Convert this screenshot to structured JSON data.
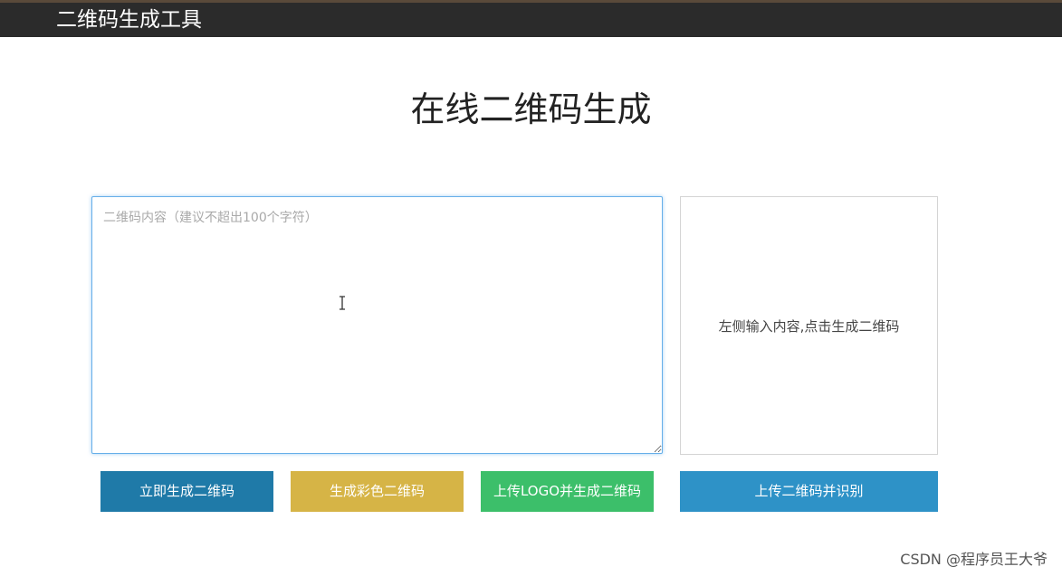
{
  "header": {
    "brand": "二维码生成工具"
  },
  "main": {
    "title": "在线二维码生成",
    "content_input": {
      "value": "",
      "placeholder": "二维码内容（建议不超出100个字符）"
    },
    "preview": {
      "hint": "左侧输入内容,点击生成二维码"
    },
    "buttons": {
      "generate": "立即生成二维码",
      "color": "生成彩色二维码",
      "logo": "上传LOGO并生成二维码",
      "upload": "上传二维码并识别"
    }
  },
  "watermark": "CSDN @程序员王大爷",
  "colors": {
    "topbar": "#2b2b2b",
    "generate": "#1f7aa8",
    "color": "#d6b446",
    "logo": "#3cbf6a",
    "upload": "#2e92c7",
    "focus_border": "#66afe9"
  },
  "icons": {
    "text_cursor": "text-cursor-icon"
  }
}
